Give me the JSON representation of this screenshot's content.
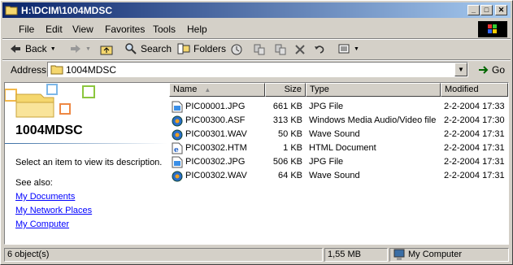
{
  "window": {
    "title": "H:\\DCIM\\1004MDSC"
  },
  "title_buttons": {
    "minimize": "_",
    "maximize": "□",
    "close": "✕"
  },
  "menu": [
    {
      "label": "File"
    },
    {
      "label": "Edit"
    },
    {
      "label": "View"
    },
    {
      "label": "Favorites"
    },
    {
      "label": "Tools"
    },
    {
      "label": "Help"
    }
  ],
  "toolbar": {
    "back": "Back",
    "search": "Search",
    "folders": "Folders"
  },
  "address": {
    "label": "Address",
    "value": "1004MDSC",
    "go": "Go"
  },
  "left_pane": {
    "folder_name": "1004MDSC",
    "hint": "Select an item to view its description.",
    "see_also": "See also:",
    "links": [
      "My Documents",
      "My Network Places",
      "My Computer"
    ]
  },
  "columns": {
    "name": "Name",
    "size": "Size",
    "type": "Type",
    "modified": "Modified"
  },
  "files": [
    {
      "name": "PIC00001.JPG",
      "size": "661 KB",
      "type": "JPG File",
      "modified": "2-2-2004 17:33",
      "icon": "jpg-file-icon"
    },
    {
      "name": "PIC00300.ASF",
      "size": "313 KB",
      "type": "Windows Media Audio/Video file",
      "modified": "2-2-2004 17:30",
      "icon": "media-file-icon"
    },
    {
      "name": "PIC00301.WAV",
      "size": "50 KB",
      "type": "Wave Sound",
      "modified": "2-2-2004 17:31",
      "icon": "media-file-icon"
    },
    {
      "name": "PIC00302.HTM",
      "size": "1 KB",
      "type": "HTML Document",
      "modified": "2-2-2004 17:31",
      "icon": "html-file-icon"
    },
    {
      "name": "PIC00302.JPG",
      "size": "506 KB",
      "type": "JPG File",
      "modified": "2-2-2004 17:31",
      "icon": "jpg-file-icon"
    },
    {
      "name": "PIC00302.WAV",
      "size": "64 KB",
      "type": "Wave Sound",
      "modified": "2-2-2004 17:31",
      "icon": "media-file-icon"
    }
  ],
  "status": {
    "objects": "6 object(s)",
    "size": "1,55 MB",
    "location": "My Computer"
  }
}
